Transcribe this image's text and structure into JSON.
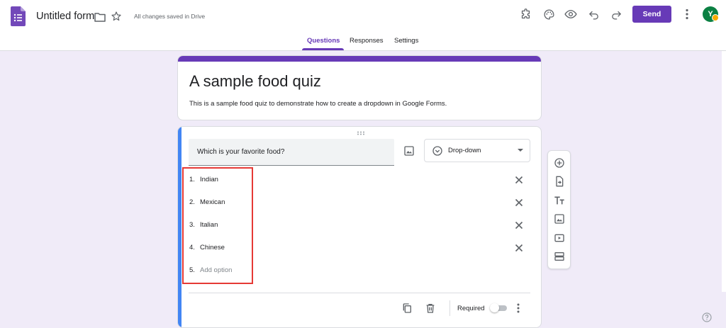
{
  "header": {
    "form_title": "Untitled form",
    "saved_status": "All changes saved in Drive",
    "send_label": "Send",
    "avatar_letter": "Y",
    "icons": [
      "forms-logo-icon",
      "folder-icon",
      "star-icon",
      "addon-puzzle-icon",
      "palette-icon",
      "preview-eye-icon",
      "undo-icon",
      "redo-icon",
      "more-vert-icon"
    ]
  },
  "tabs": [
    {
      "label": "Questions",
      "active": true
    },
    {
      "label": "Responses",
      "active": false
    },
    {
      "label": "Settings",
      "active": false
    }
  ],
  "form": {
    "title": "A sample food quiz",
    "description": "This is a sample food quiz to demonstrate how to create a dropdown in Google Forms."
  },
  "question": {
    "text": "Which is your favorite food?",
    "type": "Drop-down",
    "options": [
      {
        "num": "1.",
        "label": "Indian"
      },
      {
        "num": "2.",
        "label": "Mexican"
      },
      {
        "num": "3.",
        "label": "Italian"
      },
      {
        "num": "4.",
        "label": "Chinese"
      }
    ],
    "add_option": {
      "num": "5.",
      "label": "Add option"
    },
    "required_label": "Required",
    "required": false
  },
  "side_toolbar": [
    "add-question-icon",
    "import-questions-icon",
    "add-title-icon",
    "add-image-icon",
    "add-video-icon",
    "add-section-icon"
  ],
  "colors": {
    "accent": "#673ab7",
    "background": "#f0ebf8",
    "active_card_bar": "#4285f4",
    "highlight": "#e53935"
  }
}
